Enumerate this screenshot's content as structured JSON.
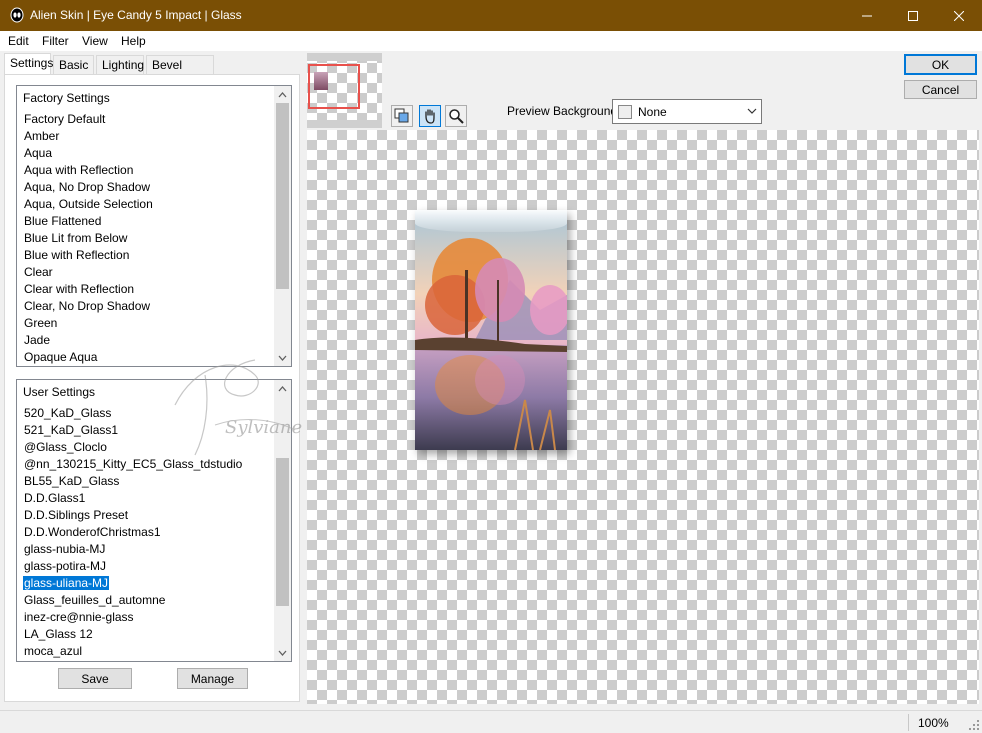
{
  "window": {
    "title": "Alien Skin | Eye Candy 5 Impact | Glass",
    "titlebar_color": "#7a4f05"
  },
  "menu": [
    {
      "label": "Edit"
    },
    {
      "label": "Filter"
    },
    {
      "label": "View"
    },
    {
      "label": "Help"
    }
  ],
  "tabs": [
    {
      "label": "Settings",
      "active": true
    },
    {
      "label": "Basic"
    },
    {
      "label": "Lighting"
    },
    {
      "label": "Bevel Profile"
    }
  ],
  "factory_settings": {
    "header": "Factory Settings",
    "items": [
      "Factory Default",
      "Amber",
      "Aqua",
      "Aqua with Reflection",
      "Aqua, No Drop Shadow",
      "Aqua, Outside Selection",
      "Blue Flattened",
      "Blue Lit from Below",
      "Blue with Reflection",
      "Clear",
      "Clear with Reflection",
      "Clear, No Drop Shadow",
      "Green",
      "Jade",
      "Opaque Aqua"
    ]
  },
  "user_settings": {
    "header": "User Settings",
    "selected": "glass-uliana-MJ",
    "items": [
      "520_KaD_Glass",
      "521_KaD_Glass1",
      "@Glass_Cloclo",
      "@nn_130215_Kitty_EC5_Glass_tdstudio",
      "BL55_KaD_Glass",
      "D.D.Glass1",
      "D.D.Siblings Preset",
      "D.D.WonderofChristmas1",
      "glass-nubia-MJ",
      "glass-potira-MJ",
      "glass-uliana-MJ",
      "Glass_feuilles_d_automne",
      "inez-cre@nnie-glass",
      "LA_Glass 12",
      "moca_azul"
    ]
  },
  "buttons": {
    "save": "Save",
    "manage": "Manage",
    "ok": "OK",
    "cancel": "Cancel"
  },
  "preview_background": {
    "label": "Preview Background:",
    "value": "None"
  },
  "watermark_text": "Sylviane",
  "status": {
    "zoom": "100%"
  },
  "icons": {
    "app": "alien-head-icon",
    "tools": [
      "navigator-icon",
      "hand-icon",
      "zoom-icon"
    ]
  },
  "colors": {
    "selection": "#0078d7",
    "navigator_frame": "#e8514c"
  }
}
